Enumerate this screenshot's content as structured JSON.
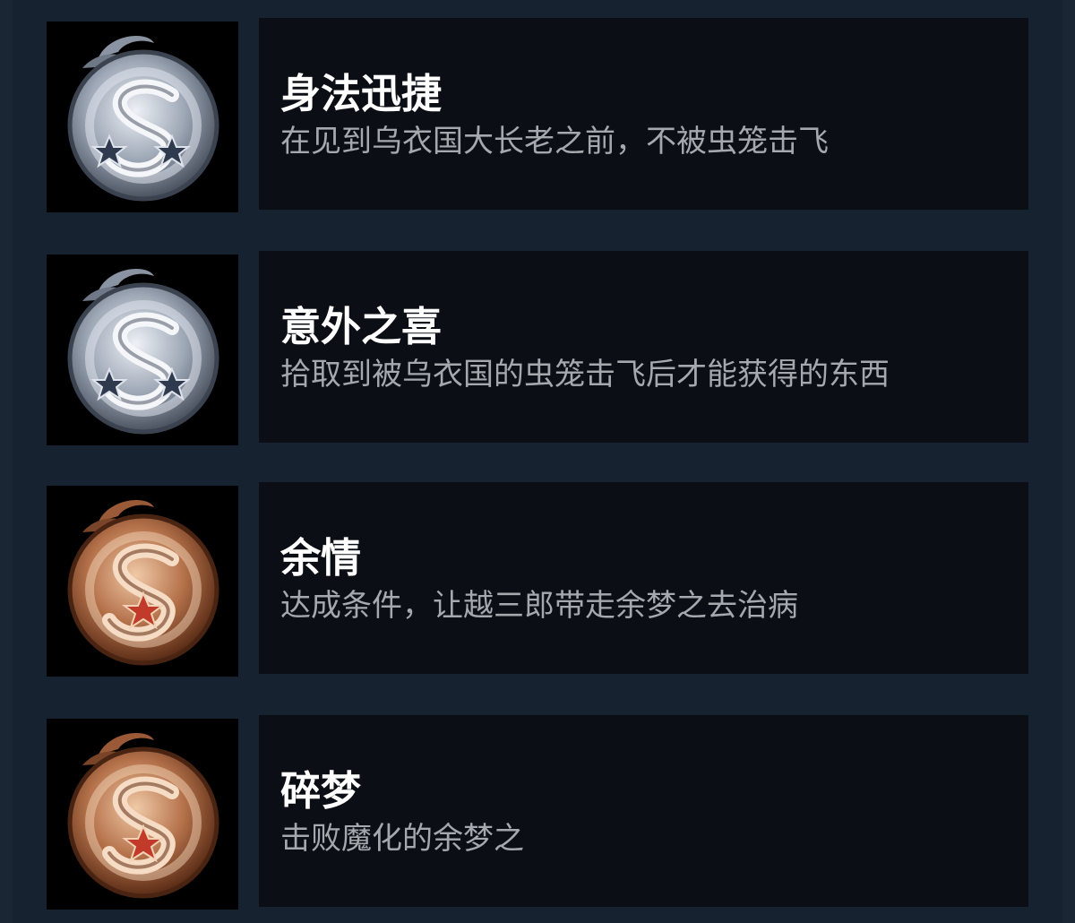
{
  "achievements": [
    {
      "title": "身法迅捷",
      "description": "在见到乌衣国大长老之前，不被虫笼击飞",
      "badge": {
        "icon": "silver-dragon-badge",
        "tier": "silver",
        "stars": 2
      }
    },
    {
      "title": "意外之喜",
      "description": "拾取到被乌衣国的虫笼击飞后才能获得的东西",
      "badge": {
        "icon": "silver-dragon-badge",
        "tier": "silver",
        "stars": 2
      }
    },
    {
      "title": "余情",
      "description": "达成条件，让越三郎带走余梦之去治病",
      "badge": {
        "icon": "bronze-dragon-badge",
        "tier": "bronze",
        "stars": 1
      }
    },
    {
      "title": "碎梦",
      "description": "击败魔化的余梦之",
      "badge": {
        "icon": "bronze-dragon-badge",
        "tier": "bronze",
        "stars": 1
      }
    }
  ],
  "colors": {
    "background": "#1a2634",
    "card": "#0b0e14",
    "title": "#ffffff",
    "description": "#a4a9ae",
    "silver": "#b4bcc8",
    "bronze": "#b4714a"
  }
}
